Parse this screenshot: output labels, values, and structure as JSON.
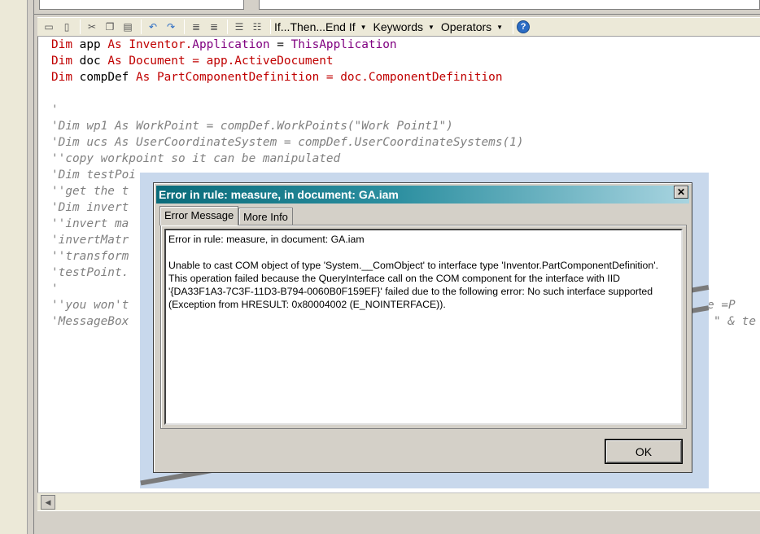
{
  "toolbar": {
    "icons": [
      "print-icon",
      "preview-icon",
      "cut-icon",
      "copy-icon",
      "paste-icon",
      "undo-icon",
      "redo-icon",
      "indent-icon",
      "outdent-icon",
      "comment-icon",
      "uncomment-icon"
    ],
    "menus": [
      {
        "label": "If...Then...End If"
      },
      {
        "label": "Keywords"
      },
      {
        "label": "Operators"
      }
    ],
    "help": "?"
  },
  "code": {
    "line1": {
      "kw1": "Dim",
      "v": " app ",
      "kw2": "As",
      "t": " Inventor.",
      "ty": "Application",
      "eq": " = ",
      "rhs": "ThisApplication"
    },
    "line2": {
      "kw1": "Dim",
      "v": " doc ",
      "kw2": "As",
      "t": " Document = app.ActiveDocument"
    },
    "line3": {
      "kw1": "Dim",
      "v": " compDef ",
      "kw2": "As",
      "t": " PartComponentDefinition = doc.ComponentDefinition"
    },
    "comments": [
      "'",
      "'Dim wp1 As WorkPoint = compDef.WorkPoints(\"Work Point1\")",
      "'Dim ucs As UserCoordinateSystem = compDef.UserCoordinateSystems(1)",
      "''copy workpoint so it can be manipulated",
      "'Dim testPoi",
      "''get the t",
      "'Dim invert",
      "''invert ma",
      "'invertMatr",
      "''transform",
      "'testPoint.",
      "'",
      "''you won't",
      "'MessageBox"
    ],
    "ghost_right1": "e =P",
    "ghost_right2": "\" & te"
  },
  "dialog": {
    "title": "Error in rule: measure, in document: GA.iam",
    "close": "✕",
    "tabs": [
      "Error Message",
      "More Info"
    ],
    "message_header": "Error in rule: measure, in document: GA.iam",
    "message_body": "Unable to cast COM object of type 'System.__ComObject' to interface type 'Inventor.PartComponentDefinition'. This operation failed because the QueryInterface call on the COM component for the interface with IID '{DA33F1A3-7C3F-11D3-B794-0060B0F159EF}' failed due to the following error: No such interface supported (Exception from HRESULT: 0x80004002 (E_NOINTERFACE)).",
    "ok": "OK"
  },
  "colors": {
    "keyword": "#c00000",
    "type": "#800080",
    "comment": "#808080",
    "title_bar": "#0a6b7a"
  }
}
